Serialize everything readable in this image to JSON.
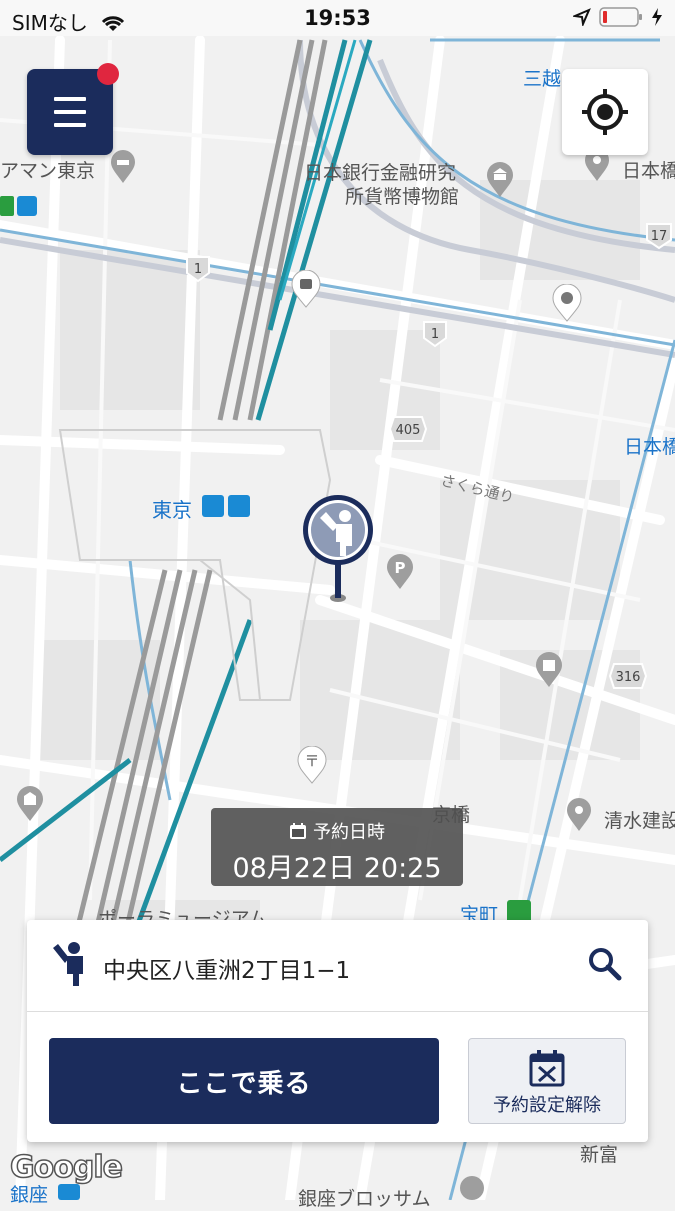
{
  "status_bar": {
    "carrier": "SIMなし",
    "time": "19:53"
  },
  "map_labels": {
    "mitsukoshi": "三越",
    "mandarin": "アマン東京",
    "boj_museum_1": "日本銀行金融研究",
    "boj_museum_2": "所貨幣博物館",
    "nihonbashi_top": "日本橋",
    "nihonbashi_mid": "日本橋",
    "tokyo_station": "東京",
    "sakura_dori": "さくら通り",
    "kyobashi": "京橋",
    "shimizu": "清水建設",
    "takaracho": "宝町",
    "museum": "ポーラミュージアム",
    "ginza": "銀座",
    "ginza_brossom": "銀座ブロッサム",
    "shintomi": "新富",
    "route_1a": "1",
    "route_1b": "1",
    "route_17": "17",
    "route_405": "405",
    "route_316": "316"
  },
  "reservation": {
    "label": "予約日時",
    "datetime": "08月22日 20:25"
  },
  "panel": {
    "address": "中央区八重洲2丁目1−1",
    "ride_button": "ここで乗る",
    "cancel_button": "予約設定解除"
  },
  "colors": {
    "navy": "#1b2c5c",
    "notification": "#e0263f",
    "rail_teal": "#1f8fa0"
  },
  "icons": {
    "menu": "hamburger-icon",
    "locate": "crosshair-icon",
    "pin": "hail-person-pin-icon",
    "search": "search-icon",
    "calendar": "calendar-icon",
    "cancel": "calendar-x-icon"
  }
}
